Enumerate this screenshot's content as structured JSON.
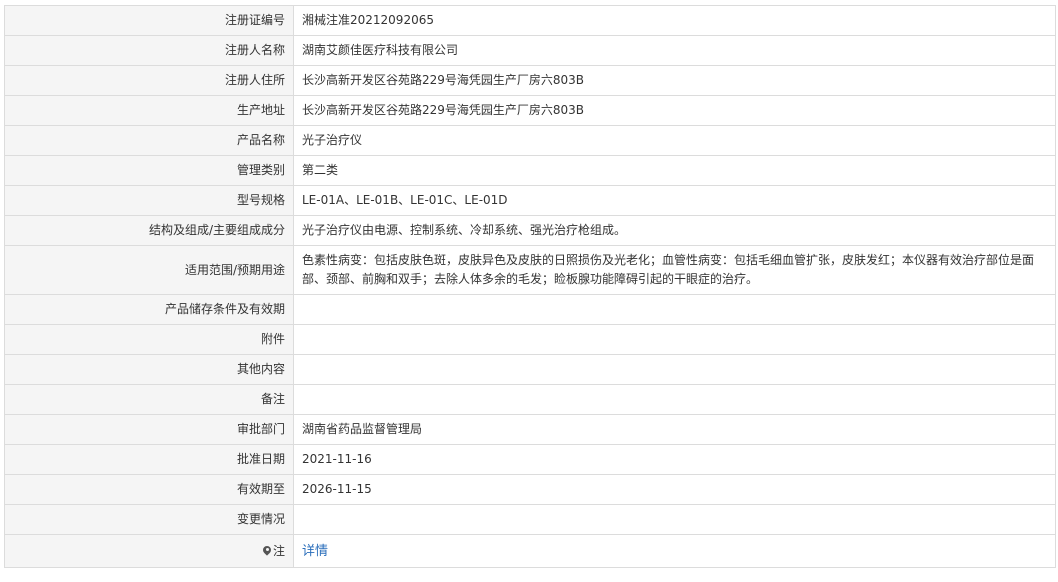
{
  "rows": [
    {
      "label": "注册证编号",
      "value": "湘械注准20212092065"
    },
    {
      "label": "注册人名称",
      "value": "湖南艾颜佳医疗科技有限公司"
    },
    {
      "label": "注册人住所",
      "value": "长沙高新开发区谷苑路229号海凭园生产厂房六803B"
    },
    {
      "label": "生产地址",
      "value": "长沙高新开发区谷苑路229号海凭园生产厂房六803B"
    },
    {
      "label": "产品名称",
      "value": "光子治疗仪"
    },
    {
      "label": "管理类别",
      "value": "第二类"
    },
    {
      "label": "型号规格",
      "value": "LE-01A、LE-01B、LE-01C、LE-01D"
    },
    {
      "label": "结构及组成/主要组成成分",
      "value": "光子治疗仪由电源、控制系统、冷却系统、强光治疗枪组成。"
    },
    {
      "label": "适用范围/预期用途",
      "value": "色素性病变：包括皮肤色斑，皮肤异色及皮肤的日照损伤及光老化；血管性病变：包括毛细血管扩张，皮肤发红；本仪器有效治疗部位是面部、颈部、前胸和双手；去除人体多余的毛发；睑板腺功能障碍引起的干眼症的治疗。"
    },
    {
      "label": "产品储存条件及有效期",
      "value": ""
    },
    {
      "label": "附件",
      "value": ""
    },
    {
      "label": "其他内容",
      "value": ""
    },
    {
      "label": "备注",
      "value": ""
    },
    {
      "label": "审批部门",
      "value": "湖南省药品监督管理局"
    },
    {
      "label": "批准日期",
      "value": "2021-11-16"
    },
    {
      "label": "有效期至",
      "value": "2026-11-15"
    },
    {
      "label": "变更情况",
      "value": ""
    }
  ],
  "note": {
    "icon": "map-pin-icon",
    "label": "注",
    "link_text": "详情"
  }
}
